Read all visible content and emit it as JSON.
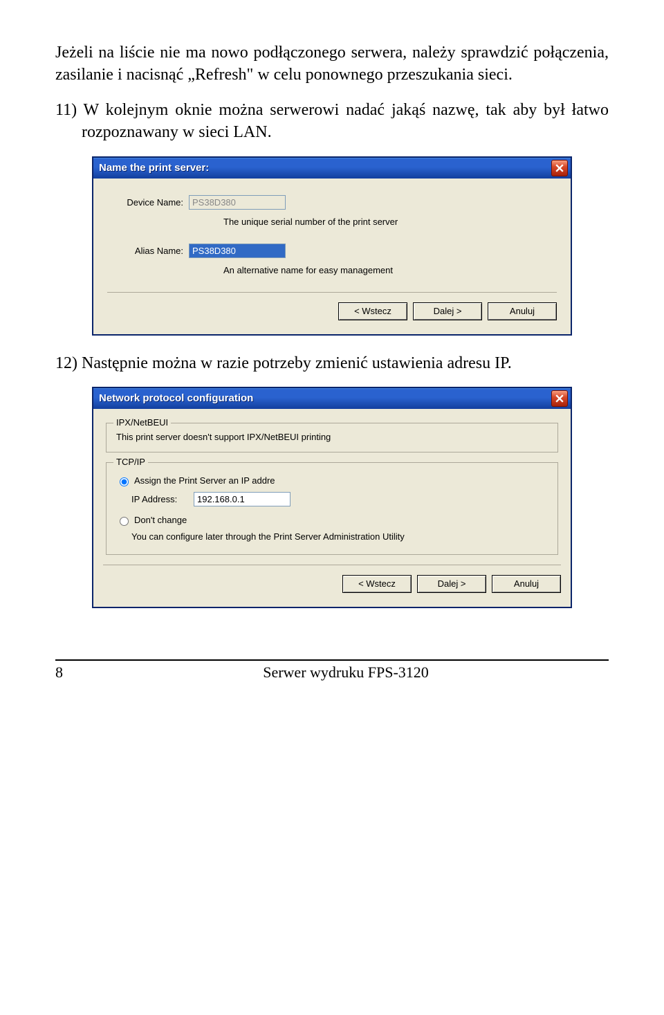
{
  "para1": "Jeżeli na liście nie ma nowo podłączonego serwera, należy sprawdzić połączenia, zasilanie i nacisnąć „Refresh\" w celu ponownego przeszukania sieci.",
  "item11": "11) W kolejnym oknie można serwerowi nadać jakąś nazwę, tak aby był łatwo rozpoznawany w sieci LAN.",
  "item12": "12) Następnie można w razie potrzeby zmienić ustawienia adresu IP.",
  "dialog1": {
    "title": "Name the print server:",
    "device_label": "Device Name:",
    "device_value": "PS38D380",
    "device_hint": "The unique serial number of the print server",
    "alias_label": "Alias Name:",
    "alias_value": "PS38D380",
    "alias_hint": "An alternative name for easy management",
    "back": "< Wstecz",
    "next": "Dalej >",
    "cancel": "Anuluj"
  },
  "dialog2": {
    "title": "Network protocol configuration",
    "group1_title": "IPX/NetBEUI",
    "group1_text": "This print server doesn't support IPX/NetBEUI printing",
    "group2_title": "TCP/IP",
    "opt_assign": "Assign the Print Server an IP addre",
    "ip_label": "IP Address:",
    "ip_value": "192.168.0.1",
    "opt_dont": "Don't change",
    "note": "You can configure later through the Print Server Administration Utility",
    "back": "< Wstecz",
    "next": "Dalej >",
    "cancel": "Anuluj"
  },
  "footer": {
    "page": "8",
    "title": "Serwer wydruku FPS-3120"
  }
}
